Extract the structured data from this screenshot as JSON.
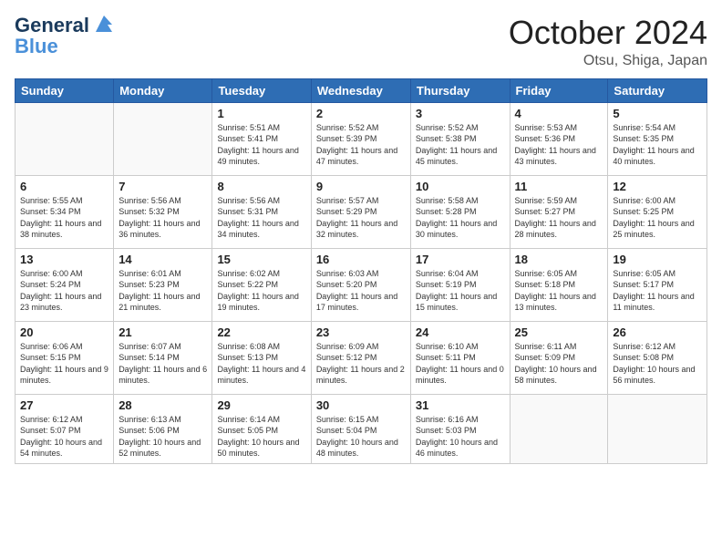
{
  "header": {
    "logo_line1": "General",
    "logo_line2": "Blue",
    "month_title": "October 2024",
    "location": "Otsu, Shiga, Japan"
  },
  "weekdays": [
    "Sunday",
    "Monday",
    "Tuesday",
    "Wednesday",
    "Thursday",
    "Friday",
    "Saturday"
  ],
  "weeks": [
    [
      {
        "day": "",
        "info": ""
      },
      {
        "day": "",
        "info": ""
      },
      {
        "day": "1",
        "info": "Sunrise: 5:51 AM\nSunset: 5:41 PM\nDaylight: 11 hours and 49 minutes."
      },
      {
        "day": "2",
        "info": "Sunrise: 5:52 AM\nSunset: 5:39 PM\nDaylight: 11 hours and 47 minutes."
      },
      {
        "day": "3",
        "info": "Sunrise: 5:52 AM\nSunset: 5:38 PM\nDaylight: 11 hours and 45 minutes."
      },
      {
        "day": "4",
        "info": "Sunrise: 5:53 AM\nSunset: 5:36 PM\nDaylight: 11 hours and 43 minutes."
      },
      {
        "day": "5",
        "info": "Sunrise: 5:54 AM\nSunset: 5:35 PM\nDaylight: 11 hours and 40 minutes."
      }
    ],
    [
      {
        "day": "6",
        "info": "Sunrise: 5:55 AM\nSunset: 5:34 PM\nDaylight: 11 hours and 38 minutes."
      },
      {
        "day": "7",
        "info": "Sunrise: 5:56 AM\nSunset: 5:32 PM\nDaylight: 11 hours and 36 minutes."
      },
      {
        "day": "8",
        "info": "Sunrise: 5:56 AM\nSunset: 5:31 PM\nDaylight: 11 hours and 34 minutes."
      },
      {
        "day": "9",
        "info": "Sunrise: 5:57 AM\nSunset: 5:29 PM\nDaylight: 11 hours and 32 minutes."
      },
      {
        "day": "10",
        "info": "Sunrise: 5:58 AM\nSunset: 5:28 PM\nDaylight: 11 hours and 30 minutes."
      },
      {
        "day": "11",
        "info": "Sunrise: 5:59 AM\nSunset: 5:27 PM\nDaylight: 11 hours and 28 minutes."
      },
      {
        "day": "12",
        "info": "Sunrise: 6:00 AM\nSunset: 5:25 PM\nDaylight: 11 hours and 25 minutes."
      }
    ],
    [
      {
        "day": "13",
        "info": "Sunrise: 6:00 AM\nSunset: 5:24 PM\nDaylight: 11 hours and 23 minutes."
      },
      {
        "day": "14",
        "info": "Sunrise: 6:01 AM\nSunset: 5:23 PM\nDaylight: 11 hours and 21 minutes."
      },
      {
        "day": "15",
        "info": "Sunrise: 6:02 AM\nSunset: 5:22 PM\nDaylight: 11 hours and 19 minutes."
      },
      {
        "day": "16",
        "info": "Sunrise: 6:03 AM\nSunset: 5:20 PM\nDaylight: 11 hours and 17 minutes."
      },
      {
        "day": "17",
        "info": "Sunrise: 6:04 AM\nSunset: 5:19 PM\nDaylight: 11 hours and 15 minutes."
      },
      {
        "day": "18",
        "info": "Sunrise: 6:05 AM\nSunset: 5:18 PM\nDaylight: 11 hours and 13 minutes."
      },
      {
        "day": "19",
        "info": "Sunrise: 6:05 AM\nSunset: 5:17 PM\nDaylight: 11 hours and 11 minutes."
      }
    ],
    [
      {
        "day": "20",
        "info": "Sunrise: 6:06 AM\nSunset: 5:15 PM\nDaylight: 11 hours and 9 minutes."
      },
      {
        "day": "21",
        "info": "Sunrise: 6:07 AM\nSunset: 5:14 PM\nDaylight: 11 hours and 6 minutes."
      },
      {
        "day": "22",
        "info": "Sunrise: 6:08 AM\nSunset: 5:13 PM\nDaylight: 11 hours and 4 minutes."
      },
      {
        "day": "23",
        "info": "Sunrise: 6:09 AM\nSunset: 5:12 PM\nDaylight: 11 hours and 2 minutes."
      },
      {
        "day": "24",
        "info": "Sunrise: 6:10 AM\nSunset: 5:11 PM\nDaylight: 11 hours and 0 minutes."
      },
      {
        "day": "25",
        "info": "Sunrise: 6:11 AM\nSunset: 5:09 PM\nDaylight: 10 hours and 58 minutes."
      },
      {
        "day": "26",
        "info": "Sunrise: 6:12 AM\nSunset: 5:08 PM\nDaylight: 10 hours and 56 minutes."
      }
    ],
    [
      {
        "day": "27",
        "info": "Sunrise: 6:12 AM\nSunset: 5:07 PM\nDaylight: 10 hours and 54 minutes."
      },
      {
        "day": "28",
        "info": "Sunrise: 6:13 AM\nSunset: 5:06 PM\nDaylight: 10 hours and 52 minutes."
      },
      {
        "day": "29",
        "info": "Sunrise: 6:14 AM\nSunset: 5:05 PM\nDaylight: 10 hours and 50 minutes."
      },
      {
        "day": "30",
        "info": "Sunrise: 6:15 AM\nSunset: 5:04 PM\nDaylight: 10 hours and 48 minutes."
      },
      {
        "day": "31",
        "info": "Sunrise: 6:16 AM\nSunset: 5:03 PM\nDaylight: 10 hours and 46 minutes."
      },
      {
        "day": "",
        "info": ""
      },
      {
        "day": "",
        "info": ""
      }
    ]
  ]
}
